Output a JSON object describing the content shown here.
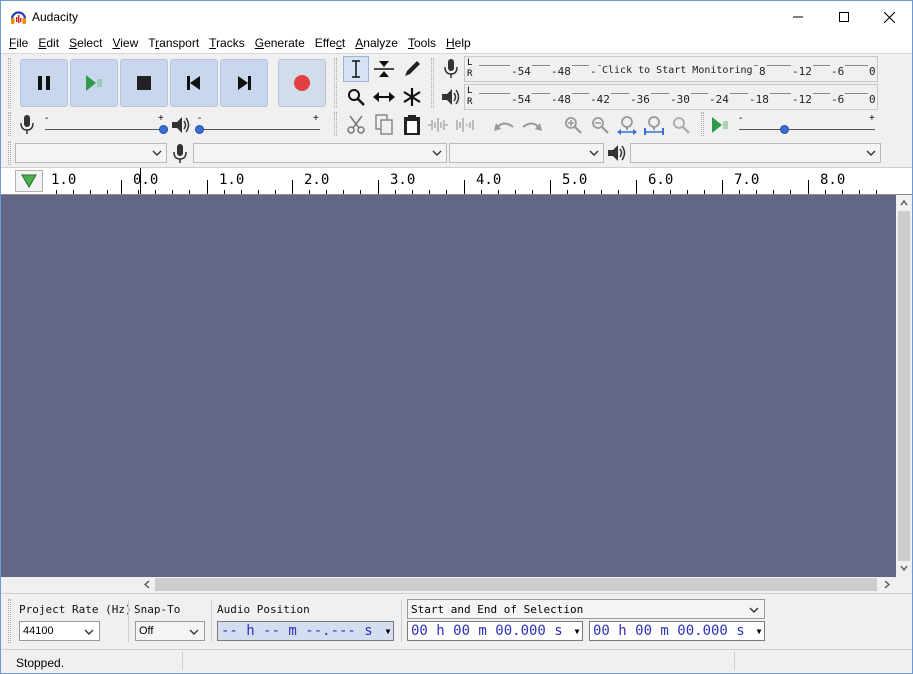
{
  "window": {
    "title": "Audacity",
    "controls": [
      "minimize",
      "maximize",
      "close"
    ]
  },
  "menu": [
    {
      "label": "File",
      "key": "F"
    },
    {
      "label": "Edit",
      "key": "E"
    },
    {
      "label": "Select",
      "key": "S"
    },
    {
      "label": "View",
      "key": "V"
    },
    {
      "label": "Transport",
      "key": "r"
    },
    {
      "label": "Tracks",
      "key": "T"
    },
    {
      "label": "Generate",
      "key": "G"
    },
    {
      "label": "Effect",
      "key": "c"
    },
    {
      "label": "Analyze",
      "key": "A"
    },
    {
      "label": "Tools",
      "key": "T"
    },
    {
      "label": "Help",
      "key": "H"
    }
  ],
  "transport": {
    "buttons": [
      "pause",
      "play",
      "stop",
      "skip-to-start",
      "skip-to-end",
      "record"
    ],
    "record_color": "#e04040",
    "play_color": "#2f9a4a"
  },
  "meters": {
    "record": {
      "channels": [
        "L",
        "R"
      ],
      "ticks": [
        "-54",
        "-48",
        "-",
        "8",
        "-12",
        "-6",
        "0"
      ],
      "prompt": "Click to Start Monitoring"
    },
    "playback": {
      "channels": [
        "L",
        "R"
      ],
      "ticks": [
        "-54",
        "-48",
        "-42",
        "-36",
        "-30",
        "-24",
        "-18",
        "-12",
        "-6",
        "0"
      ]
    }
  },
  "mixer": {
    "record_min": "-",
    "record_max": "+",
    "playback_min": "-",
    "playback_max": "+"
  },
  "ruler": {
    "labels": [
      "1.0",
      "0.0",
      "1.0",
      "2.0",
      "3.0",
      "4.0",
      "5.0",
      "6.0",
      "7.0",
      "8.0"
    ]
  },
  "selection_toolbar": {
    "project_rate_label": "Project Rate (Hz)",
    "project_rate_value": "44100",
    "snap_to_label": "Snap-To",
    "snap_to_value": "Off",
    "audio_position_label": "Audio Position",
    "audio_position_value": "-- h -- m --.--- s",
    "selection_mode": "Start and End of Selection",
    "selection_start": "00 h 00 m 00.000 s",
    "selection_end": "00 h 00 m 00.000 s"
  },
  "status": {
    "text": "Stopped."
  },
  "colors": {
    "track_background": "#636787",
    "transport_button": "#c9d7ee",
    "time_text": "#2f2fb8"
  }
}
